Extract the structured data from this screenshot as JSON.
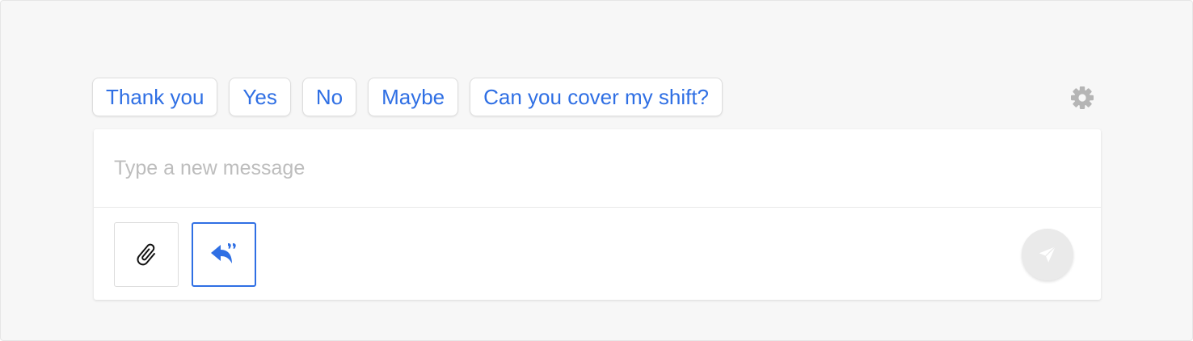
{
  "quick_replies": [
    {
      "label": "Thank you"
    },
    {
      "label": "Yes"
    },
    {
      "label": "No"
    },
    {
      "label": "Maybe"
    },
    {
      "label": "Can you cover my shift?"
    }
  ],
  "settings": {
    "icon": "gear-icon"
  },
  "composer": {
    "placeholder": "Type a new message",
    "value": "",
    "attach_icon": "paperclip-icon",
    "quick_reply_icon": "quick-reply-icon",
    "send_icon": "send-icon"
  },
  "colors": {
    "accent": "#2f6fe4",
    "background": "#f7f7f7",
    "placeholder": "#bdbdbd",
    "send_disabled": "#eaeaea",
    "icon_gray": "#b5b5b5"
  }
}
